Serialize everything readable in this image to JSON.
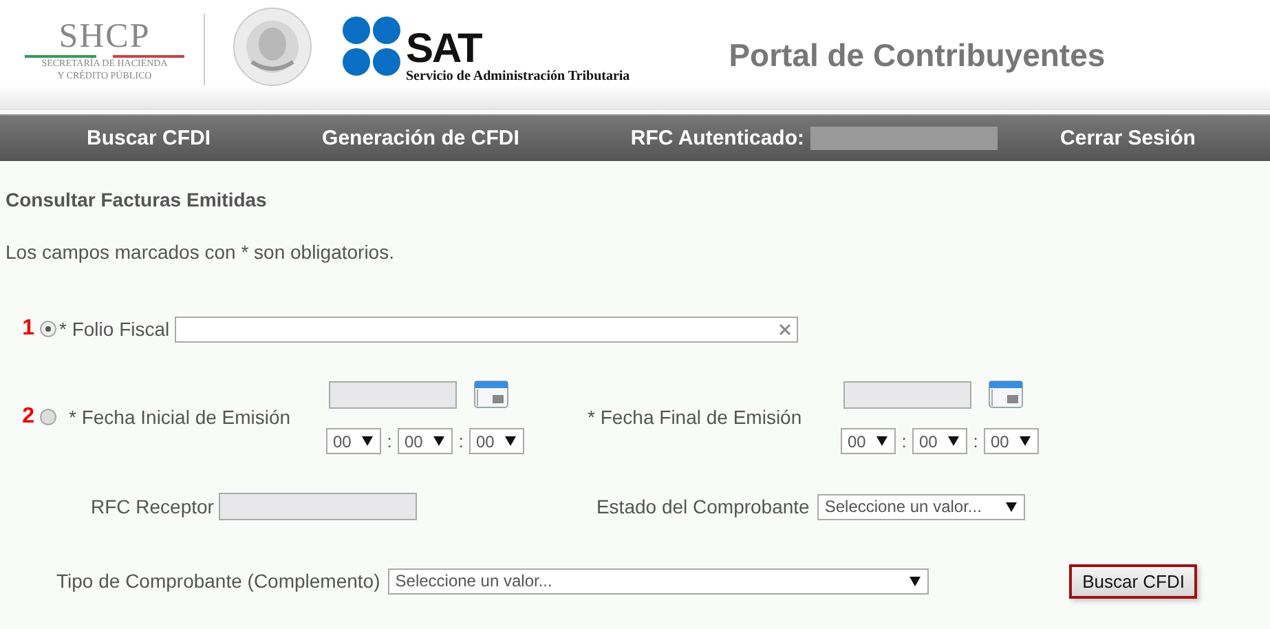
{
  "header": {
    "shcp_logo": {
      "acronym": "SHCP",
      "line_1": "SECRETARÍA DE HACIENDA",
      "line_2": "Y CRÉDITO PÚBLICO"
    },
    "sat_logo": {
      "acronym": "SAT",
      "subtitle": "Servicio de Administración Tributaria"
    },
    "portal_title": "Portal de Contribuyentes"
  },
  "nav": {
    "items": [
      {
        "label": "Buscar CFDI"
      },
      {
        "label": "Generación de CFDI"
      }
    ],
    "rfc_label": "RFC Autenticado:",
    "logout": "Cerrar Sesión"
  },
  "page_title": "Consultar Facturas Emitidas",
  "note": "Los campos marcados con * son obligatorios.",
  "options": [
    {
      "number": "1",
      "selected": true
    },
    {
      "number": "2",
      "selected": false
    }
  ],
  "folio": {
    "label": "* Folio Fiscal"
  },
  "dates": [
    {
      "label": "* Fecha Inicial de Emisión",
      "time": [
        "00",
        "00",
        "00"
      ]
    },
    {
      "label": "* Fecha Final de Emisión",
      "time": [
        "00",
        "00",
        "00"
      ]
    }
  ],
  "time_separator": ":",
  "rfc_receptor": {
    "label": "RFC Receptor"
  },
  "estado": {
    "label": "Estado del Comprobante",
    "value": "Seleccione un valor..."
  },
  "tipo": {
    "label": "Tipo de Comprobante (Complemento)",
    "value": "Seleccione un valor..."
  },
  "search_button": "Buscar CFDI"
}
